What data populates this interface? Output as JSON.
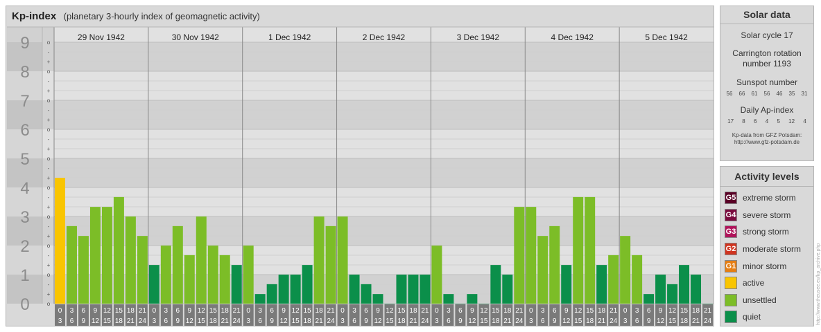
{
  "header": {
    "title": "Kp-index",
    "subtitle": "(planetary 3-hourly index of geomagnetic activity)"
  },
  "chart_data": {
    "type": "bar",
    "title": "Kp-index",
    "subtitle": "(planetary 3-hourly index of geomagnetic activity)",
    "ylim": [
      0,
      9
    ],
    "yticks": [
      "0",
      "1",
      "2",
      "3",
      "4",
      "5",
      "6",
      "7",
      "8",
      "9"
    ],
    "minor_tick_labels": [
      "o",
      "+",
      "-"
    ],
    "days": [
      "29 Nov 1942",
      "30 Nov 1942",
      "1 Dec 1942",
      "2 Dec 1942",
      "3 Dec 1942",
      "4 Dec 1942",
      "5 Dec 1942"
    ],
    "interval_start_labels": [
      "0",
      "3",
      "6",
      "9",
      "12",
      "15",
      "18",
      "21"
    ],
    "interval_end_labels": [
      "3",
      "6",
      "9",
      "12",
      "15",
      "18",
      "21",
      "24"
    ],
    "values": [
      4.33,
      2.67,
      2.33,
      3.33,
      3.33,
      3.67,
      3.0,
      2.33,
      1.33,
      2.0,
      2.67,
      1.67,
      3.0,
      2.0,
      1.67,
      1.33,
      2.0,
      0.33,
      0.67,
      1.0,
      1.0,
      1.33,
      3.0,
      2.67,
      3.0,
      1.0,
      0.67,
      0.33,
      0.0,
      1.0,
      1.0,
      1.0,
      2.0,
      0.33,
      0.0,
      0.33,
      0.0,
      1.33,
      1.0,
      3.33,
      3.33,
      2.33,
      2.67,
      1.33,
      3.67,
      3.67,
      1.33,
      1.67,
      2.33,
      1.67,
      0.33,
      1.0,
      0.67,
      1.33,
      1.0,
      0.0
    ],
    "colors": {
      "quiet": "#0b8f4a",
      "unsettled": "#7cbd27",
      "active": "#f9c500"
    },
    "grid": true
  },
  "solar": {
    "title": "Solar data",
    "cycle": "Solar cycle 17",
    "carrington_1": "Carrington rotation",
    "carrington_2": "number 1193",
    "sunspot_title": "Sunspot number",
    "sunspot_values": [
      "56",
      "66",
      "61",
      "56",
      "46",
      "35",
      "31"
    ],
    "ap_title": "Daily Ap-index",
    "ap_values": [
      "17",
      "8",
      "6",
      "4",
      "5",
      "12",
      "4"
    ],
    "credit_1": "Kp-data from GFZ Potsdam:",
    "credit_2": "http://www.gfz-potsdam.de"
  },
  "levels": {
    "title": "Activity levels",
    "items": [
      {
        "badge": "G5",
        "label": "extreme storm",
        "color": "#5a0026"
      },
      {
        "badge": "G4",
        "label": "severe storm",
        "color": "#7a0a3e"
      },
      {
        "badge": "G3",
        "label": "strong storm",
        "color": "#b0135a"
      },
      {
        "badge": "G2",
        "label": "moderate storm",
        "color": "#d0341f"
      },
      {
        "badge": "G1",
        "label": "minor storm",
        "color": "#e67e12"
      },
      {
        "badge": "",
        "label": "active",
        "color": "#f9c500"
      },
      {
        "badge": "",
        "label": "unsettled",
        "color": "#7cbd27"
      },
      {
        "badge": "",
        "label": "quiet",
        "color": "#0b8f4a"
      }
    ]
  },
  "watermark": "http://www.theusee.eu/kp_archive.php"
}
